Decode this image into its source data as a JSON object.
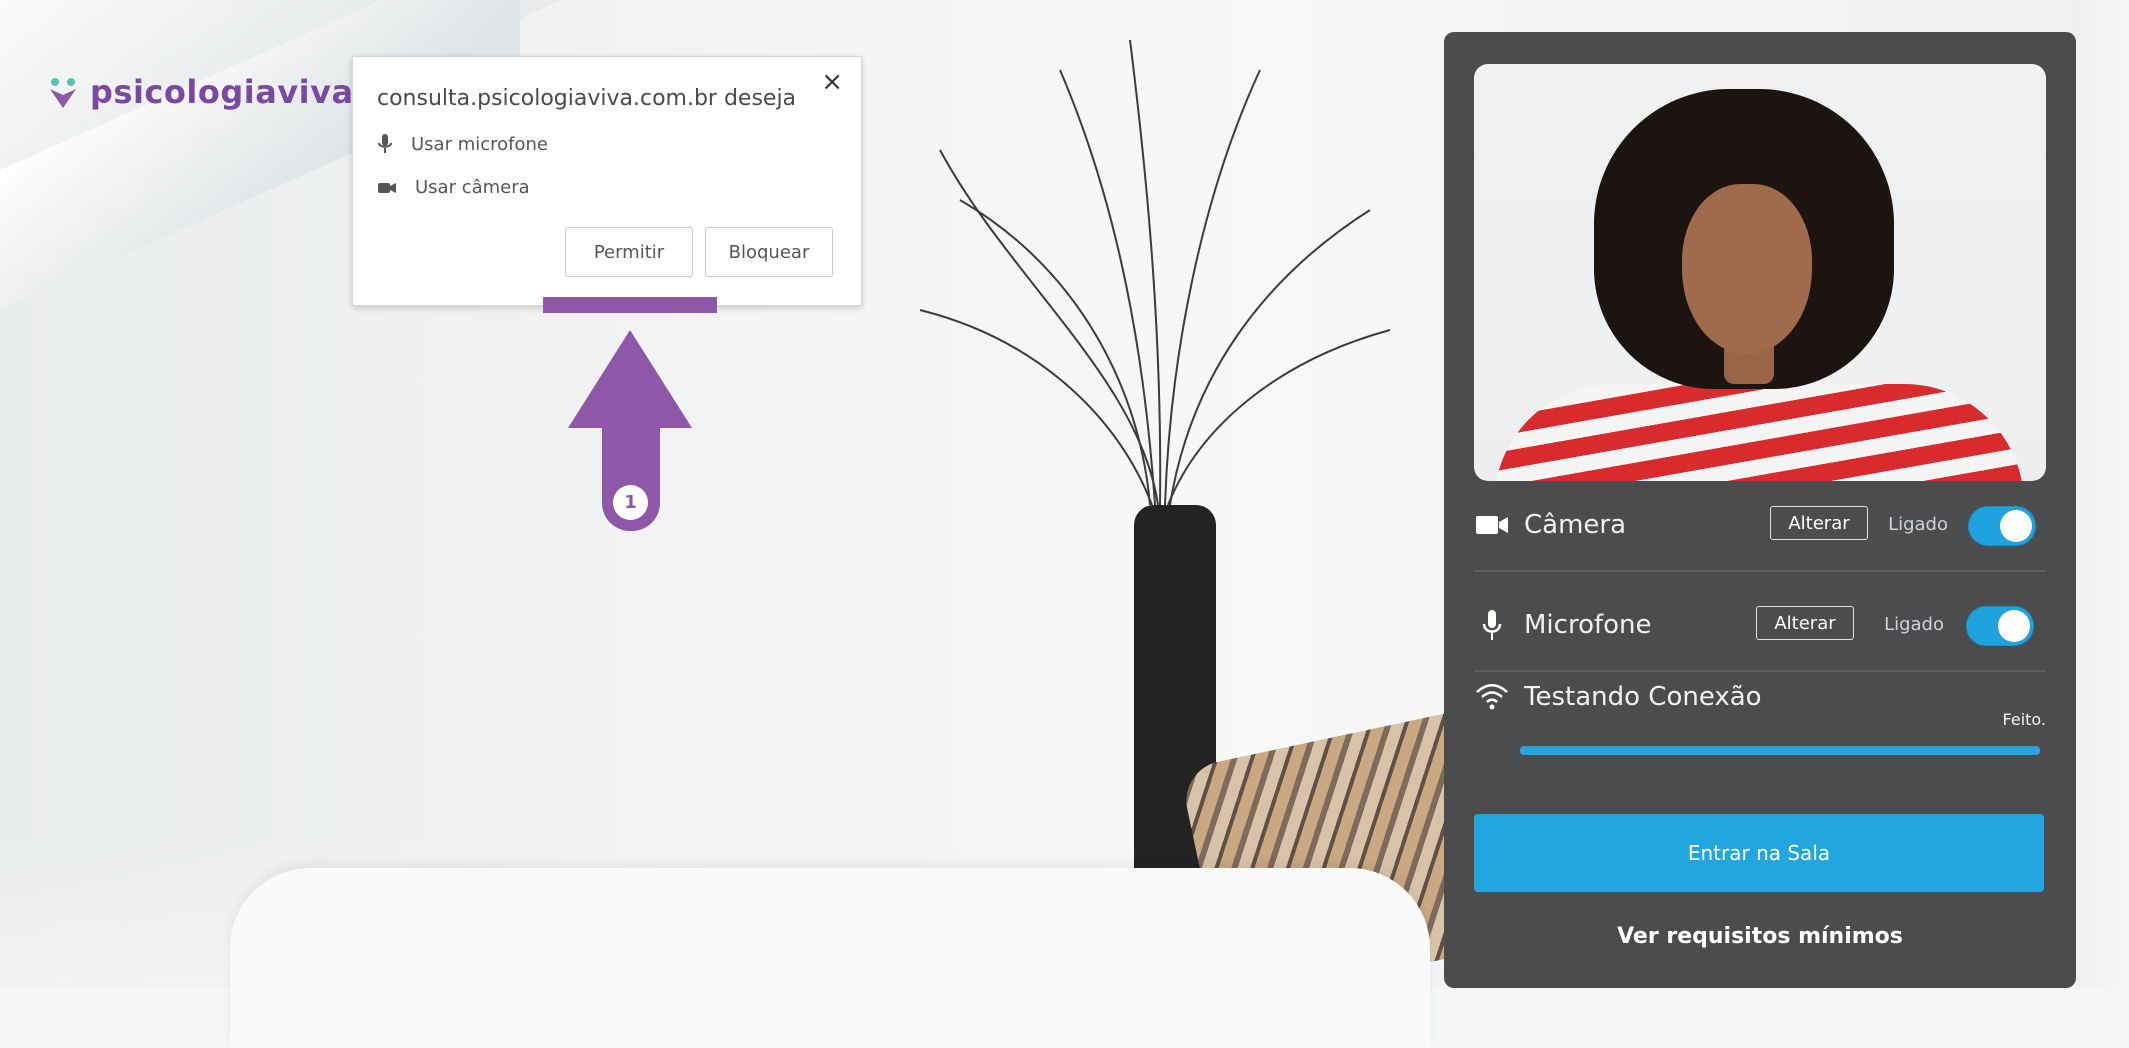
{
  "logo": {
    "text": "psicologiaviva",
    "color": "#7a4aa2"
  },
  "permission": {
    "site": "consulta.psicologiaviva.com.br deseja",
    "close_symbol": "×",
    "items": [
      {
        "label": "Usar microfone",
        "icon": "microphone-icon"
      },
      {
        "label": "Usar câmera",
        "icon": "camera-icon"
      }
    ],
    "buttons": {
      "allow": "Permitir",
      "block": "Bloquear"
    }
  },
  "annotation": {
    "step": "1",
    "color": "#8e57a8"
  },
  "panel": {
    "camera": {
      "label": "Câmera",
      "change": "Alterar",
      "state": "Ligado"
    },
    "microphone": {
      "label": "Microfone",
      "change": "Alterar",
      "state": "Ligado"
    },
    "connection": {
      "label": "Testando Conexão",
      "status": "Feito.",
      "progress": 1.0
    },
    "enter_button": "Entrar na Sala",
    "requirements_link": "Ver requisitos mínimos",
    "accent": "#22a6e0"
  }
}
